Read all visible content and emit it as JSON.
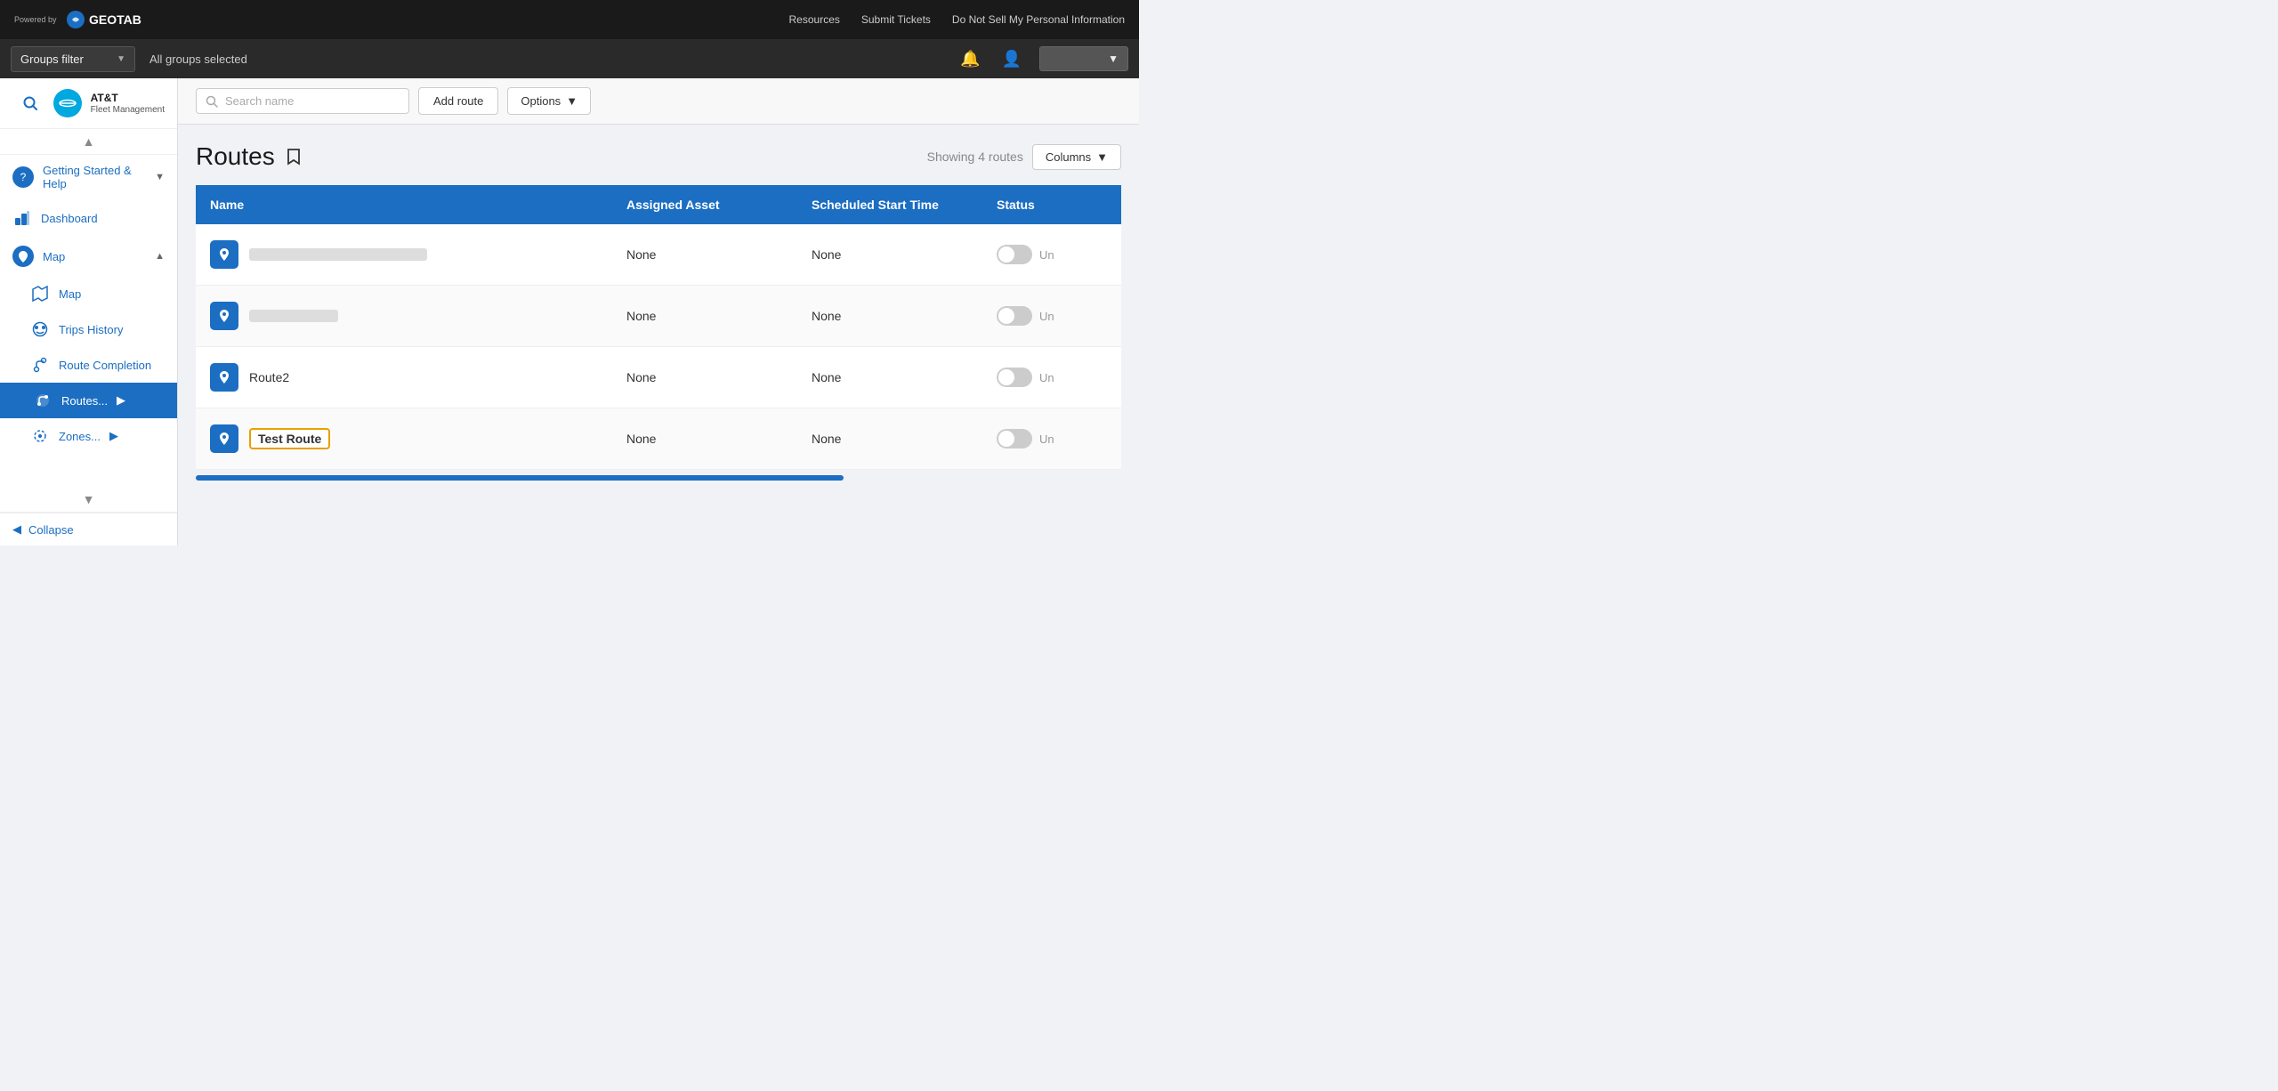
{
  "topbar": {
    "logo": {
      "powered_by": "Powered by",
      "brand": "GEOTAB"
    },
    "nav_links": [
      {
        "label": "Resources",
        "key": "resources"
      },
      {
        "label": "Submit Tickets",
        "key": "submit-tickets"
      },
      {
        "label": "Do Not Sell My Personal Information",
        "key": "do-not-sell"
      }
    ]
  },
  "secondbar": {
    "groups_filter_label": "Groups filter",
    "all_groups_label": "All groups selected",
    "bell_icon": "🔔",
    "user_icon": "👤"
  },
  "sidebar": {
    "brand": "AT&T",
    "sub_brand": "Fleet Management",
    "nav_items": [
      {
        "label": "Getting Started & Help",
        "key": "getting-started",
        "has_arrow": true,
        "icon": "?",
        "circle": true
      },
      {
        "label": "Dashboard",
        "key": "dashboard",
        "icon": "📊",
        "circle": false
      },
      {
        "label": "Map",
        "key": "map",
        "icon": "map",
        "circle": true,
        "expanded": true
      },
      {
        "label": "Map",
        "key": "map-sub",
        "sub": true
      },
      {
        "label": "Trips History",
        "key": "trips-history",
        "sub": true
      },
      {
        "label": "Route Completion",
        "key": "route-completion",
        "sub": true
      },
      {
        "label": "Routes...",
        "key": "routes",
        "sub": true,
        "has_arrow": true,
        "active": true
      },
      {
        "label": "Zones...",
        "key": "zones",
        "sub": true,
        "has_arrow": true
      }
    ],
    "collapse_label": "Collapse"
  },
  "toolbar": {
    "search_placeholder": "Search name",
    "add_route_label": "Add route",
    "options_label": "Options"
  },
  "main": {
    "title": "Routes",
    "showing_text": "Showing 4 routes",
    "columns_label": "Columns",
    "table": {
      "headers": [
        "Name",
        "Assigned Asset",
        "Scheduled Start Time",
        "Status"
      ],
      "rows": [
        {
          "name": "",
          "name_blurred": true,
          "name_blurred_long": true,
          "assigned_asset": "None",
          "scheduled_start_time": "None",
          "status": "Un"
        },
        {
          "name": "",
          "name_blurred": true,
          "name_blurred_long": false,
          "assigned_asset": "None",
          "scheduled_start_time": "None",
          "status": "Un"
        },
        {
          "name": "Route2",
          "name_blurred": false,
          "assigned_asset": "None",
          "scheduled_start_time": "None",
          "status": "Un"
        },
        {
          "name": "Test Route",
          "name_blurred": false,
          "highlighted": true,
          "assigned_asset": "None",
          "scheduled_start_time": "None",
          "status": "Un"
        }
      ]
    }
  }
}
